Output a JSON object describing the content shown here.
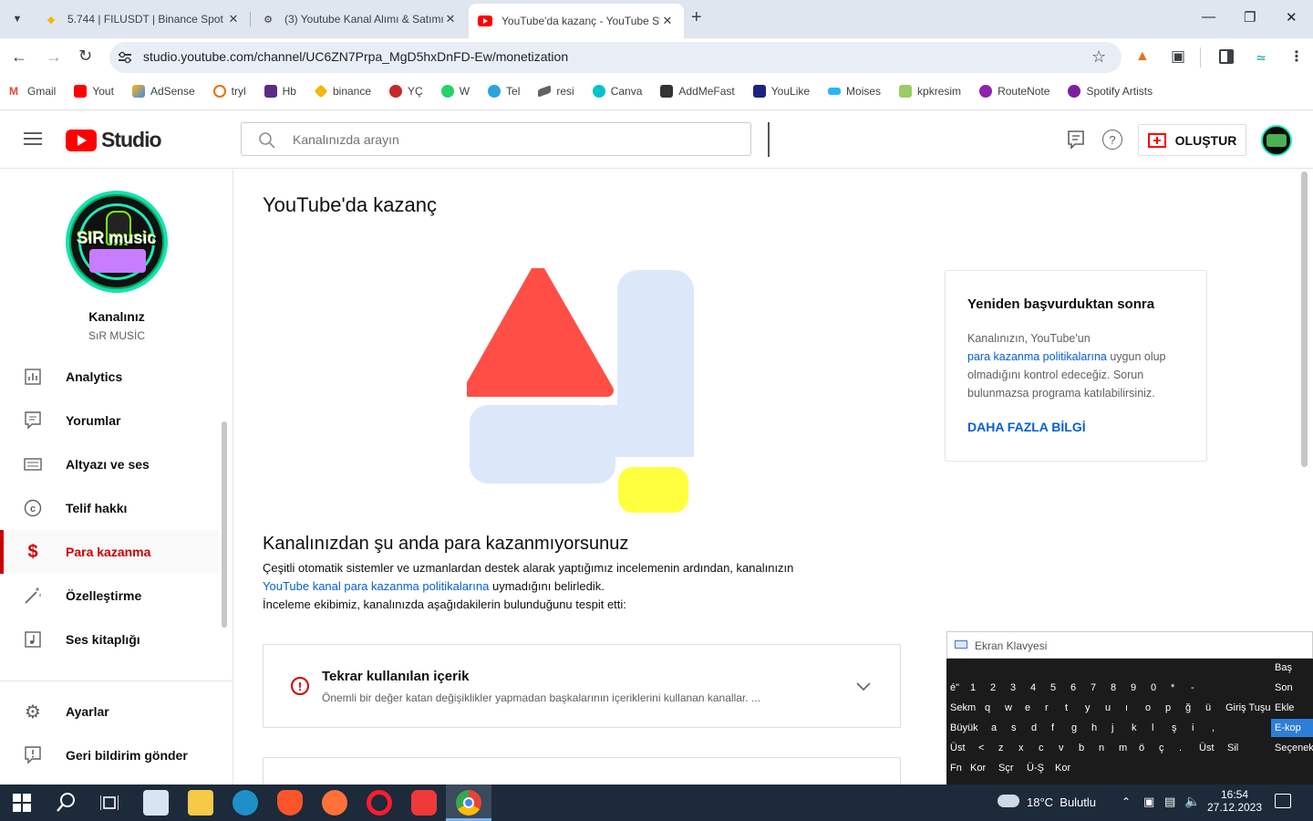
{
  "browser": {
    "tabs": [
      {
        "title": "5.744 | FILUSDT | Binance Spot",
        "icon": "binance-icon"
      },
      {
        "title": "(3) Youtube Kanal Alımı & Satımı",
        "icon": "forum-icon"
      },
      {
        "title": "YouTube'da kazanç - YouTube Studio",
        "icon": "youtube-icon"
      }
    ],
    "new_tab": "+",
    "url": "studio.youtube.com/channel/UC6ZN7Prpa_MgD5hxDnFD-Ew/monetization",
    "bookmarks": [
      "Gmail",
      "Yout",
      "AdSense",
      "tryl",
      "Hb",
      "binance",
      "YÇ",
      "W",
      "Tel",
      "resi",
      "Canva",
      "AddMeFast",
      "YouLike",
      "Moises",
      "kpkresim",
      "RouteNote",
      "Spotify Artists"
    ]
  },
  "studio": {
    "logo_text": "Studio",
    "search_placeholder": "Kanalınızda arayın",
    "create_label": "OLUŞTUR",
    "channel_label": "Kanalınız",
    "channel_name": "SıR MUSİC",
    "avatar_text": "SIR music",
    "nav": [
      {
        "label": "Analytics",
        "icon": "analytics-icon"
      },
      {
        "label": "Yorumlar",
        "icon": "comments-icon"
      },
      {
        "label": "Altyazı ve ses",
        "icon": "subtitles-icon"
      },
      {
        "label": "Telif hakkı",
        "icon": "copyright-icon"
      },
      {
        "label": "Para kazanma",
        "icon": "dollar-icon",
        "active": true
      },
      {
        "label": "Özelleştirme",
        "icon": "magic-wand-icon"
      },
      {
        "label": "Ses kitaplığı",
        "icon": "audio-library-icon"
      }
    ],
    "nav_bottom": [
      {
        "label": "Ayarlar",
        "icon": "settings-icon"
      },
      {
        "label": "Geri bildirim gönder",
        "icon": "feedback-icon"
      }
    ]
  },
  "main": {
    "title": "YouTube'da kazanç",
    "status_heading": "Kanalınızdan şu anda para kazanmıyorsunuz",
    "status_line1": "Çeşitli otomatik sistemler ve uzmanlardan destek alarak yaptığımız incelemenin ardından, kanalınızın",
    "status_link": "YouTube kanal para kazanma politikalarına",
    "status_line2_rest": " uymadığını belirledik.",
    "status_line3": "İnceleme ekibimiz, kanalınızda aşağıdakilerin bulunduğunu tespit etti:",
    "issue": {
      "title": "Tekrar kullanılan içerik",
      "desc": "Önemli bir değer katan değişiklikler yapmadan başkalarının içeriklerini kullanan kanallar. ..."
    }
  },
  "side_card": {
    "title": "Yeniden başvurduktan sonra",
    "text1": "Kanalınızın, YouTube'un",
    "link": "para kazanma politikalarına",
    "text2": " uygun olup",
    "text3": "olmadığını kontrol edeceğiz. Sorun",
    "text4": "bulunmazsa programa katılabilirsiniz.",
    "cta": "DAHA FAZLA BİLGİ"
  },
  "osk": {
    "title": "Ekran Klavyesi",
    "rows": [
      [
        "é\"",
        "1",
        "2",
        "3",
        "4",
        "5",
        "6",
        "7",
        "8",
        "9",
        "0",
        "*",
        "-"
      ],
      [
        "Sekm",
        "q",
        "w",
        "e",
        "r",
        "t",
        "y",
        "u",
        "ı",
        "o",
        "p",
        "ğ",
        "ü",
        "Giriş Tuşu"
      ],
      [
        "Büyük",
        "a",
        "s",
        "d",
        "f",
        "g",
        "h",
        "j",
        "k",
        "l",
        "ş",
        "i",
        ","
      ],
      [
        "Üst",
        "<",
        "z",
        "x",
        "c",
        "v",
        "b",
        "n",
        "m",
        "ö",
        "ç",
        ".",
        "Üst",
        "Sil"
      ],
      [
        "Fn",
        "Kor",
        "Sçr",
        "Ü-Ş",
        "Kor"
      ]
    ],
    "side_keys": [
      "Baş",
      "Son",
      "Ekle",
      "E-kop",
      "Seçenek"
    ]
  },
  "taskbar": {
    "weather": "18°C  Bulutlu",
    "time": "16:54",
    "date": "27.12.2023"
  },
  "colors": {
    "youtube_red": "#ff0000",
    "link_blue": "#065fd4",
    "active_red": "#cc0000"
  }
}
